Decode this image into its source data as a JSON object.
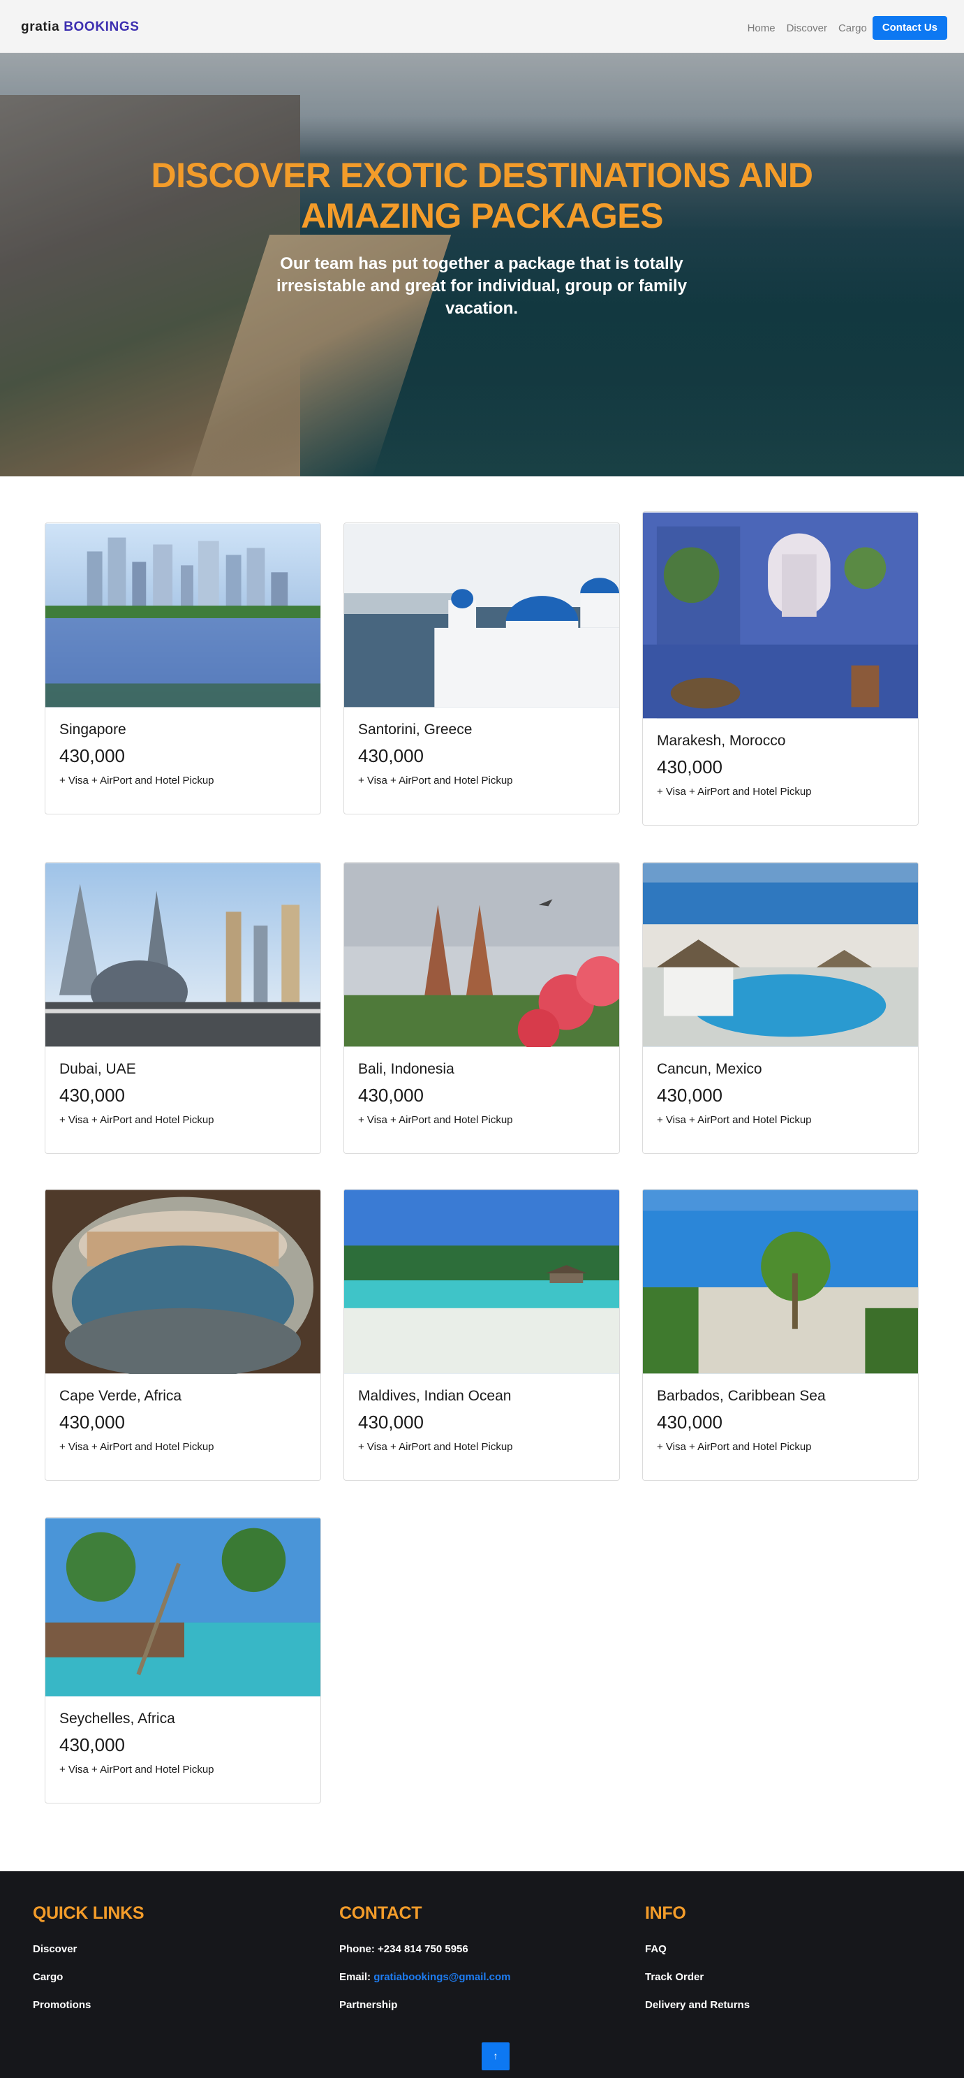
{
  "navbar": {
    "brand_part1": "gratia",
    "brand_part2": "BOOKINGS",
    "links": [
      "Home",
      "Discover",
      "Cargo"
    ],
    "contact_button": "Contact Us"
  },
  "hero": {
    "title": "DISCOVER EXOTIC DESTINATIONS AND AMAZING PACKAGES",
    "subtitle": "Our team has put together a package that is totally irresistable and great for individual, group or family vacation."
  },
  "packages": [
    {
      "destination": "Singapore",
      "price": "430,000",
      "includes": "+ Visa + AirPort and Hotel Pickup"
    },
    {
      "destination": "Santorini, Greece",
      "price": "430,000",
      "includes": "+ Visa + AirPort and Hotel Pickup"
    },
    {
      "destination": "Marakesh, Morocco",
      "price": "430,000",
      "includes": "+ Visa + AirPort and Hotel Pickup"
    },
    {
      "destination": "Dubai, UAE",
      "price": "430,000",
      "includes": "+ Visa + AirPort and Hotel Pickup"
    },
    {
      "destination": "Bali, Indonesia",
      "price": "430,000",
      "includes": "+ Visa + AirPort and Hotel Pickup"
    },
    {
      "destination": "Cancun, Mexico",
      "price": "430,000",
      "includes": "+ Visa + AirPort and Hotel Pickup"
    },
    {
      "destination": "Cape Verde, Africa",
      "price": "430,000",
      "includes": "+ Visa + AirPort and Hotel Pickup"
    },
    {
      "destination": "Maldives, Indian Ocean",
      "price": "430,000",
      "includes": "+ Visa + AirPort and Hotel Pickup"
    },
    {
      "destination": "Barbados, Caribbean Sea",
      "price": "430,000",
      "includes": "+ Visa + AirPort and Hotel Pickup"
    },
    {
      "destination": "Seychelles, Africa",
      "price": "430,000",
      "includes": "+ Visa + AirPort and Hotel Pickup"
    }
  ],
  "footer": {
    "quick_links": {
      "heading": "QUICK LINKS",
      "items": [
        "Discover",
        "Cargo",
        "Promotions"
      ]
    },
    "contact": {
      "heading": "CONTACT",
      "phone_label": "Phone:",
      "phone": "+234 814 750 5956",
      "email_label": "Email:",
      "email": "gratiabookings@gmail.com",
      "partnership": "Partnership"
    },
    "info": {
      "heading": "INFO",
      "items": [
        "FAQ",
        "Track Order",
        "Delivery and Returns"
      ]
    },
    "back_to_top_icon": "arrow-up-icon"
  },
  "colors": {
    "accent": "#f39c2a",
    "primary": "#0d78f2",
    "brand": "#3d2fb0",
    "footer_bg": "#16171b"
  }
}
